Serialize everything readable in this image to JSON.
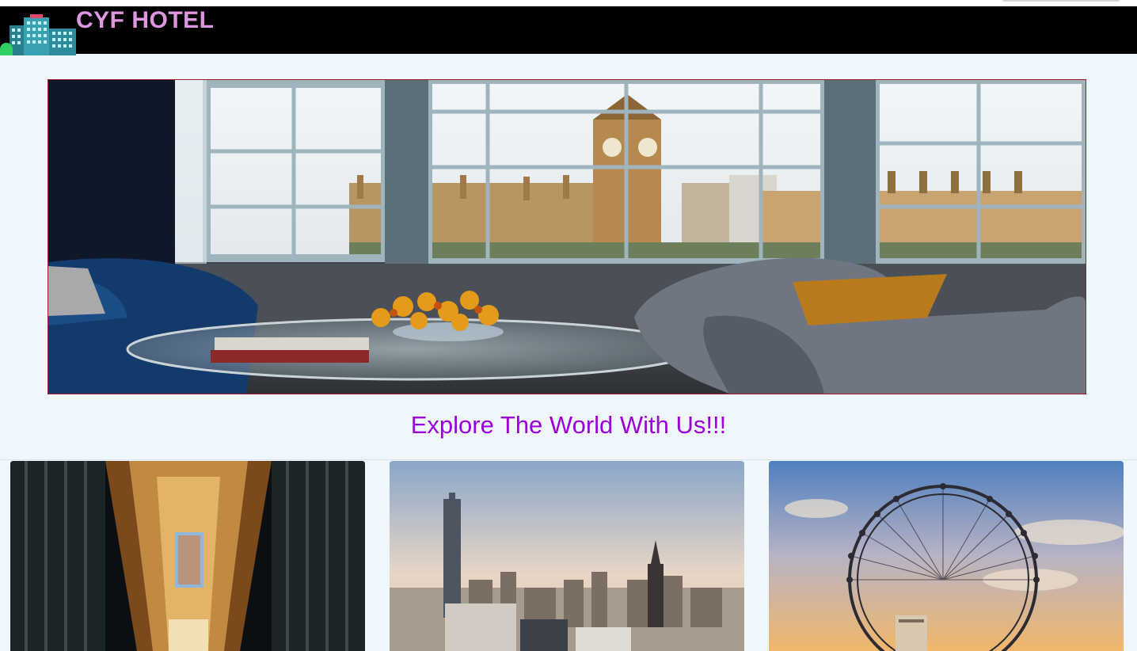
{
  "header": {
    "brand": "CYF HOTEL",
    "brand_color": "#dd96e0",
    "logo_icon": "hotel-building-icon"
  },
  "hero": {
    "image": "hotel-room-with-big-ben-view"
  },
  "tagline": {
    "text": "Explore The World With Us!!!",
    "color": "#9b00d9"
  },
  "cards": [
    {
      "image": "cathedral-interior"
    },
    {
      "image": "city-skyline"
    },
    {
      "image": "ferris-wheel"
    }
  ]
}
